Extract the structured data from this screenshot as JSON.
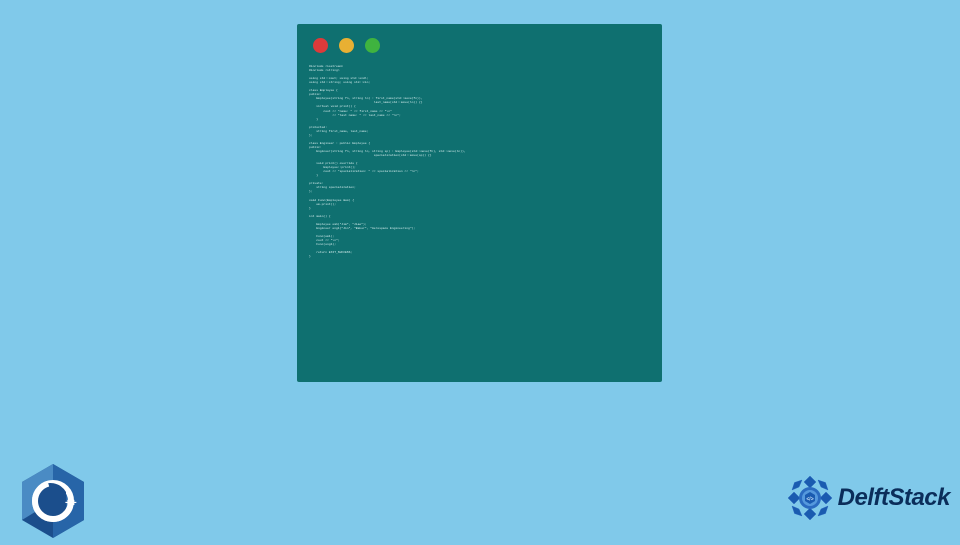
{
  "window": {
    "code": "#include <iostream>\n#include <string>\n\nusing std::cout; using std::endl;\nusing std::string; using std::cin;\n\nclass Employee {\npublic:\n    Employee(string fn, string ln) : first_name(std::move(fn)),\n                                    last_name(std::move(ln)) {}\n    virtual void print() {\n        cout << \"name: \" << first_name << \"\\n\"\n             << \"last name: \" << last_name << \"\\n\";\n    }\n\nprotected:\n    string first_name, last_name;\n};\n\nclass Engineer : public Employee {\npublic:\n    Engineer(string fn, string ln, string sp) : Employee(std::move(fn), std::move(ln)),\n                                    specialization(std::move(sp)) {}\n\n    void print() override {\n        Employee::print();\n        cout << \"specialization: \" << specialization << \"\\n\";\n    }\n\nprivate:\n    string specialization;\n};\n\nvoid Func(Employee &em) {\n    em.print();\n}\n\nint main() {\n\n    Employee em1(\"Jim\", \"Jiao\");\n    Engineer eng1(\"Jin\", \"Baker\", \"Aerospace Engineering\");\n\n    Func(em1);\n    cout << \"\\n\";\n    Func(eng1);\n\n    return EXIT_SUCCESS;\n}"
  },
  "brand": {
    "cpp_label": "C++",
    "delft_label": "DelftStack"
  }
}
